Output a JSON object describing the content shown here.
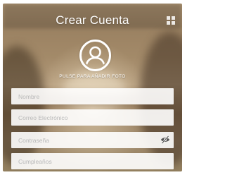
{
  "header": {
    "title": "Crear Cuenta",
    "grid_icon": "grid-icon"
  },
  "avatar": {
    "icon": "user-avatar-icon",
    "hint": "PULSE PARA AÑADIR FOTO"
  },
  "form": {
    "name_placeholder": "Nombre",
    "email_placeholder": "Correo Electrónico",
    "password_placeholder": "Contraseña",
    "password_toggle_icon": "eye-slash-icon",
    "birthday_placeholder": "Cumpleaños"
  },
  "colors": {
    "text": "#ffffff",
    "field_bg": "#ffffff",
    "placeholder": "#b9b9b9"
  }
}
